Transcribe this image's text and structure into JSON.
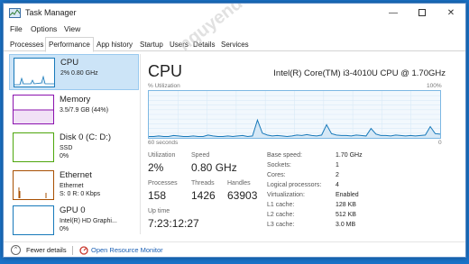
{
  "window": {
    "title": "Task Manager",
    "icon": "task-manager-icon"
  },
  "menu": [
    "File",
    "Options",
    "View"
  ],
  "tabs": [
    "Processes",
    "Performance",
    "App history",
    "Startup",
    "Users",
    "Details",
    "Services"
  ],
  "active_tab": "Performance",
  "sidebar": [
    {
      "name": "CPU",
      "sub1": "2% 0.80 GHz",
      "sub2": "",
      "color": "#1779ba"
    },
    {
      "name": "Memory",
      "sub1": "3.5/7.9 GB (44%)",
      "sub2": "",
      "color": "#8b12ae"
    },
    {
      "name": "Disk 0 (C: D:)",
      "sub1": "SSD",
      "sub2": "0%",
      "color": "#4da60c"
    },
    {
      "name": "Ethernet",
      "sub1": "Ethernet",
      "sub2": "S: 0 R: 0 Kbps",
      "color": "#a74f01"
    },
    {
      "name": "GPU 0",
      "sub1": "Intel(R) HD Graphi...",
      "sub2": "0%",
      "color": "#1779ba"
    }
  ],
  "main": {
    "title": "CPU",
    "cpu_name": "Intel(R) Core(TM) i3-4010U CPU @ 1.70GHz",
    "graph_label": "% Utilization",
    "graph_max": "100%",
    "graph_time": "60 seconds",
    "graph_min": "0",
    "stats": {
      "utilization_label": "Utilization",
      "utilization": "2%",
      "speed_label": "Speed",
      "speed": "0.80 GHz",
      "processes_label": "Processes",
      "processes": "158",
      "threads_label": "Threads",
      "threads": "1426",
      "handles_label": "Handles",
      "handles": "63903",
      "uptime_label": "Up time",
      "uptime": "7:23:12:27"
    },
    "info": [
      {
        "key": "Base speed:",
        "val": "1.70 GHz"
      },
      {
        "key": "Sockets:",
        "val": "1"
      },
      {
        "key": "Cores:",
        "val": "2"
      },
      {
        "key": "Logical processors:",
        "val": "4"
      },
      {
        "key": "Virtualization:",
        "val": "Enabled"
      },
      {
        "key": "L1 cache:",
        "val": "128 KB"
      },
      {
        "key": "L2 cache:",
        "val": "512 KB"
      },
      {
        "key": "L3 cache:",
        "val": "3.0 MB"
      }
    ],
    "utilization_history": [
      3,
      3,
      4,
      3,
      3,
      5,
      4,
      3,
      3,
      4,
      3,
      3,
      6,
      4,
      3,
      3,
      4,
      3,
      4,
      5,
      3,
      4,
      38,
      10,
      6,
      4,
      5,
      4,
      3,
      4,
      6,
      5,
      7,
      5,
      4,
      6,
      28,
      9,
      6,
      5,
      5,
      4,
      6,
      5,
      4,
      20,
      8,
      5,
      5,
      4,
      6,
      5,
      4,
      5,
      4,
      5,
      6,
      24,
      9,
      8
    ]
  },
  "footer": {
    "fewer_details": "Fewer details",
    "open_monitor": "Open Resource Monitor"
  },
  "watermark": "nguyenduy.com"
}
